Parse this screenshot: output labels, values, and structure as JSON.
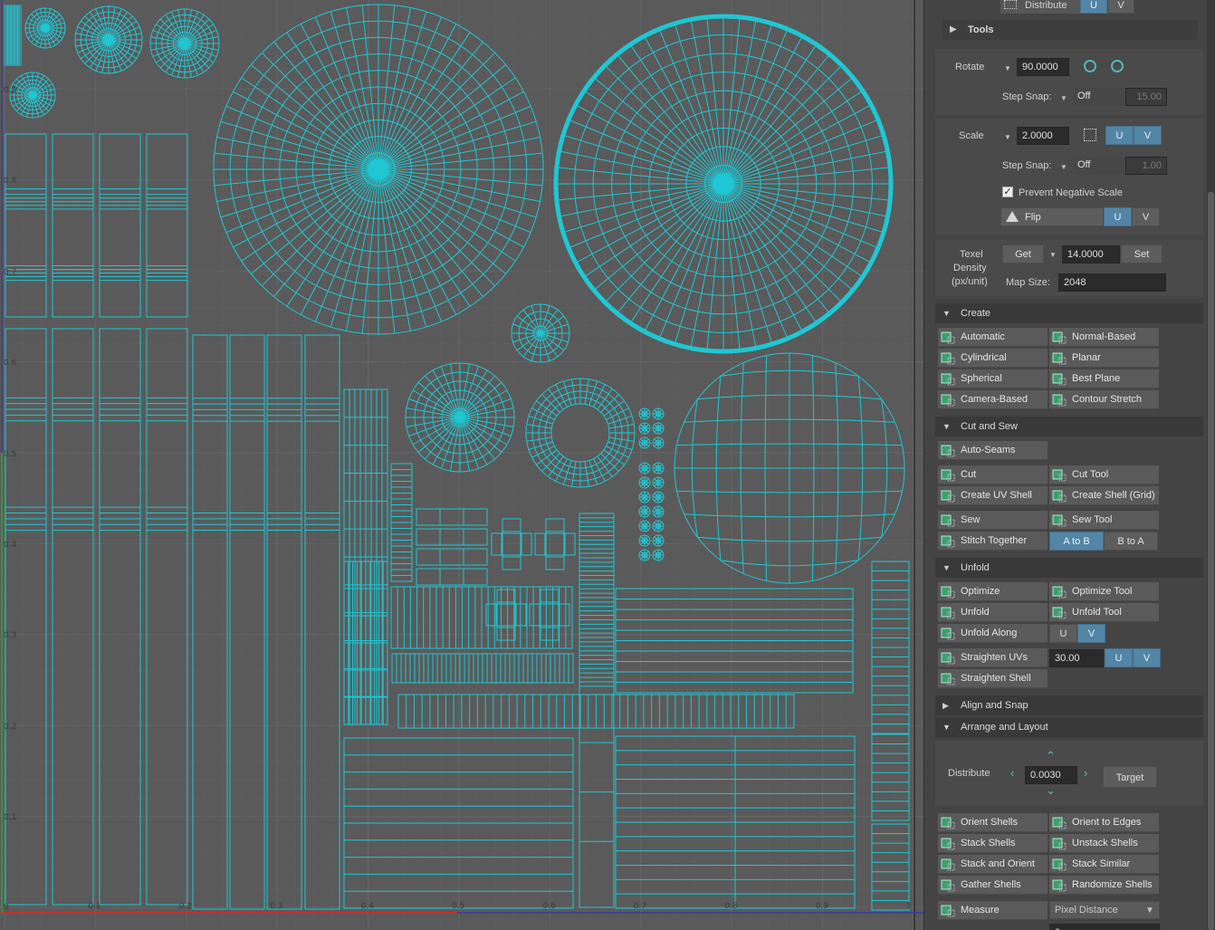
{
  "viewport": {
    "axis_labels": [
      "0.9",
      "0.8",
      "0.7",
      "0.6",
      "0.5",
      "0.4",
      "0.3",
      "0.2",
      "0.1",
      "0",
      "0.1",
      "0.2",
      "0.3",
      "0.4",
      "0.5",
      "0.6",
      "0.7",
      "0.8",
      "0.9",
      "1"
    ],
    "wire_color": "#1fc7d4",
    "grid_color": "#676767"
  },
  "top_bar": {
    "distribute_label": "Distribute",
    "u": "U",
    "v": "V"
  },
  "tools": {
    "header": "Tools",
    "rotate_label": "Rotate",
    "rotate_value": "90.0000",
    "step_snap_label": "Step Snap:",
    "rotate_snap_mode": "Off",
    "rotate_snap_value": "15.00",
    "scale_label": "Scale",
    "scale_value": "2.0000",
    "scale_snap_mode": "Off",
    "scale_snap_value": "1.00",
    "u": "U",
    "v": "V",
    "prevent_negative": "Prevent Negative Scale",
    "flip_label": "Flip",
    "texel_label_1": "Texel",
    "texel_label_2": "Density",
    "texel_label_3": "(px/unit)",
    "get_label": "Get",
    "texel_value": "14.0000",
    "set_label": "Set",
    "map_size_label": "Map Size:",
    "map_size_value": "2048"
  },
  "create": {
    "header": "Create",
    "items": [
      "Automatic",
      "Normal-Based",
      "Cylindrical",
      "Planar",
      "Spherical",
      "Best Plane",
      "Camera-Based",
      "Contour Stretch"
    ]
  },
  "cut_sew": {
    "header": "Cut and Sew",
    "auto_seams": "Auto-Seams",
    "items": [
      "Cut",
      "Cut Tool",
      "Create UV Shell",
      "Create Shell (Grid)",
      "Sew",
      "Sew Tool"
    ],
    "stitch": "Stitch Together",
    "a_to_b": "A to B",
    "b_to_a": "B to A"
  },
  "unfold": {
    "header": "Unfold",
    "items": [
      "Optimize",
      "Optimize Tool",
      "Unfold",
      "Unfold Tool"
    ],
    "unfold_along": "Unfold Along",
    "u": "U",
    "v": "V",
    "straighten_uvs": "Straighten UVs",
    "straighten_value": "30.00",
    "straighten_shell": "Straighten Shell"
  },
  "align_snap": {
    "header": "Align and Snap"
  },
  "arrange": {
    "header": "Arrange and Layout",
    "distribute_label": "Distribute",
    "distribute_value": "0.0030",
    "target_label": "Target",
    "items": [
      "Orient Shells",
      "Orient to Edges",
      "Stack Shells",
      "Unstack Shells",
      "Stack and Orient",
      "Stack Similar",
      "Gather Shells",
      "Randomize Shells"
    ],
    "measure": "Measure",
    "measure_mode": "Pixel Distance",
    "measure_value": "0"
  }
}
